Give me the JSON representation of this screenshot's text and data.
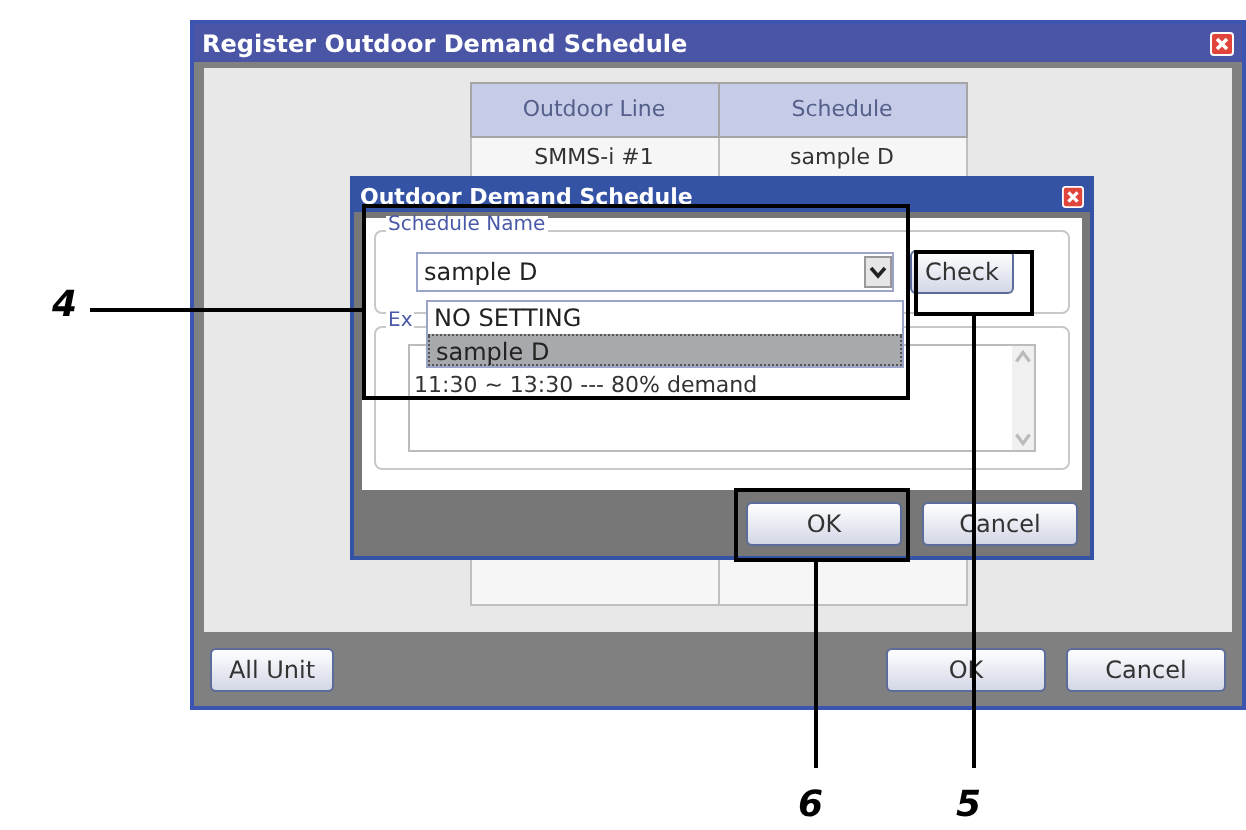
{
  "window": {
    "title": "Register Outdoor Demand Schedule"
  },
  "table": {
    "columns": [
      "Outdoor Line",
      "Schedule"
    ],
    "rows": [
      [
        "SMMS-i #1",
        "sample D"
      ]
    ]
  },
  "dialog": {
    "title": "Outdoor Demand Schedule",
    "schedule_group": "Schedule Name",
    "select_value": "sample D",
    "options": [
      {
        "label": "NO SETTING",
        "selected": false
      },
      {
        "label": "sample D",
        "selected": true
      }
    ],
    "check_button": "Check",
    "explanation_group": "Ex",
    "explanation": "11:30 ~ 13:30 --- 80% demand",
    "buttons": [
      "OK",
      "Cancel"
    ]
  },
  "footer": {
    "left_button": "All Unit",
    "buttons": [
      "OK",
      "Cancel"
    ]
  },
  "callouts": [
    "4",
    "5",
    "6"
  ]
}
